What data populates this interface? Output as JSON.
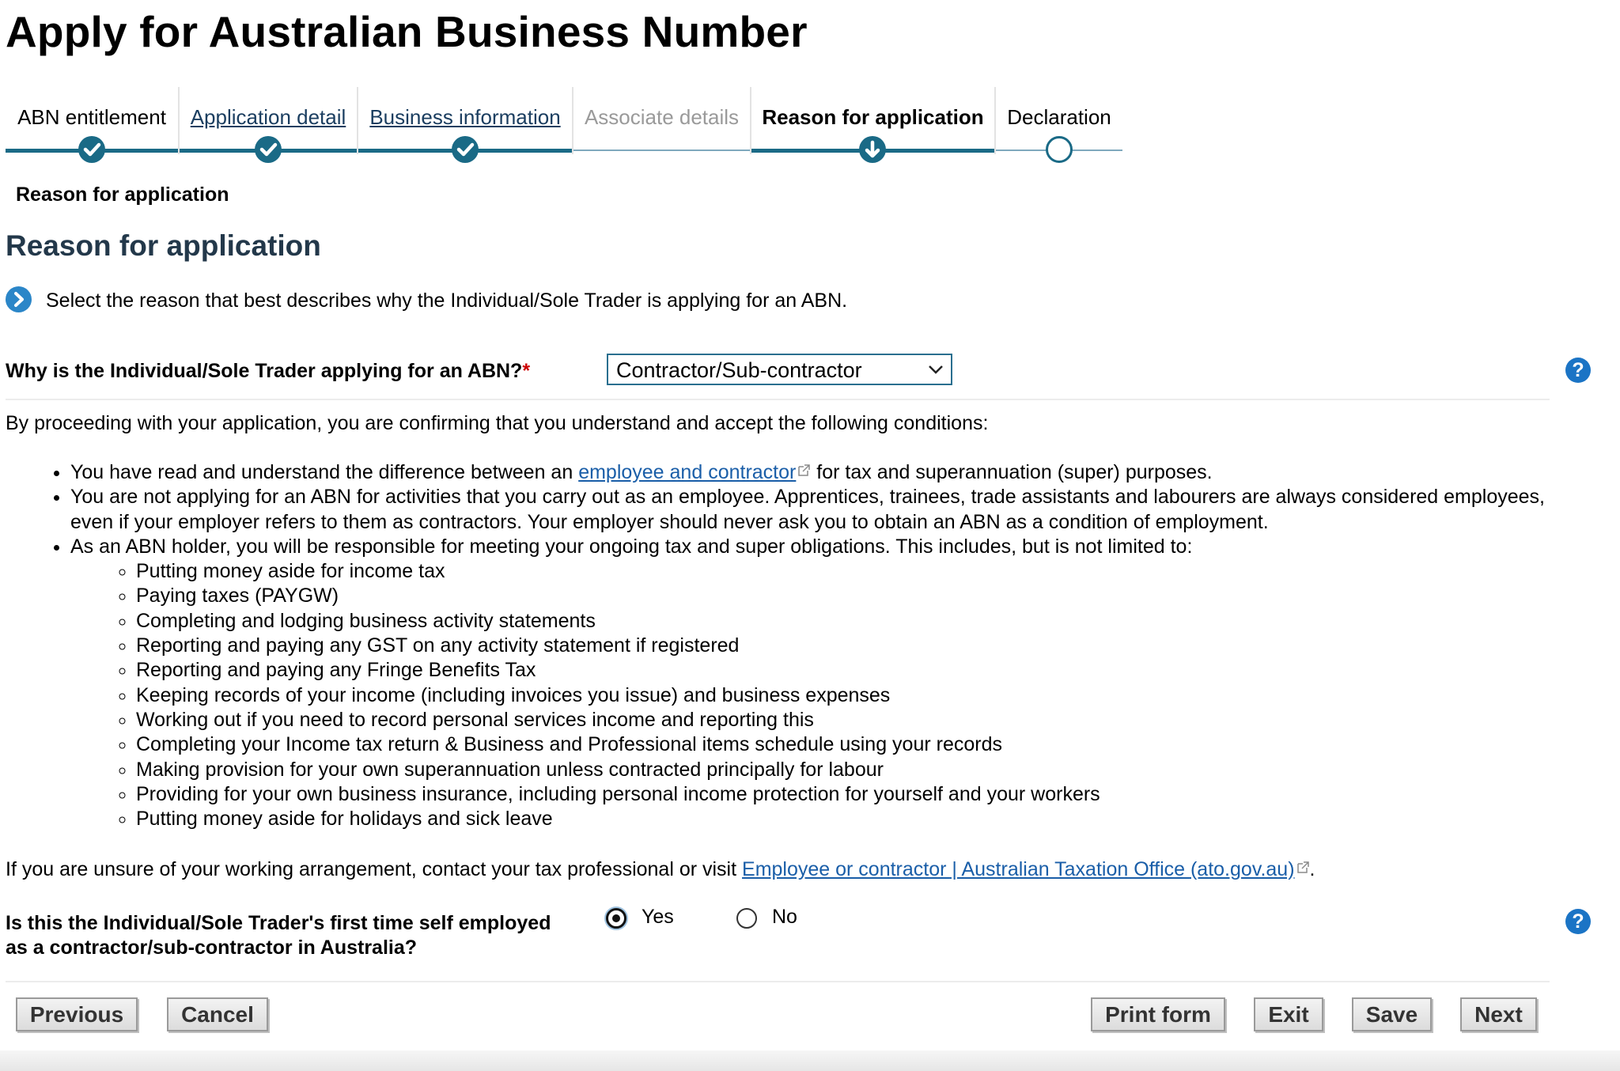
{
  "page": {
    "title": "Apply for Australian Business Number"
  },
  "steps": [
    {
      "label": "ABN entitlement",
      "state": "complete"
    },
    {
      "label": "Application detail",
      "state": "complete"
    },
    {
      "label": "Business information",
      "state": "complete"
    },
    {
      "label": "Associate details",
      "state": "disabled"
    },
    {
      "label": "Reason for application",
      "state": "current"
    },
    {
      "label": "Declaration",
      "state": "pending"
    }
  ],
  "breadcrumb": {
    "current": "Reason for application"
  },
  "section": {
    "heading": "Reason for application",
    "info_text": "Select the reason that best describes why the Individual/Sole Trader is applying for an ABN."
  },
  "question1": {
    "label": "Why is the Individual/Sole Trader applying for an ABN?",
    "required_mark": "*",
    "selected_value": "Contractor/Sub-contractor"
  },
  "conditions": {
    "intro": "By proceeding with your application, you are confirming that you understand and accept the following conditions:",
    "bullet1_before": "You have read and understand the difference between an ",
    "bullet1_link": "employee and contractor",
    "bullet1_after": " for tax and superannuation (super) purposes.",
    "bullet2": "You are not applying for an ABN for activities that you carry out as an employee. Apprentices, trainees, trade assistants and labourers are always considered employees, even if your employer refers to them as contractors. Your employer should never ask you to obtain an ABN as a condition of employment.",
    "bullet3": "As an ABN holder, you will be responsible for meeting your ongoing tax and super obligations. This includes, but is not limited to:",
    "obligations": [
      "Putting money aside for income tax",
      "Paying taxes (PAYGW)",
      "Completing and lodging business activity statements",
      "Reporting and paying any GST on any activity statement if registered",
      "Reporting and paying any Fringe Benefits Tax",
      "Keeping records of your income (including invoices you issue) and business expenses",
      "Working out if you need to record personal services income and reporting this",
      "Completing your Income tax return & Business and Professional items schedule using your records",
      "Making provision for your own superannuation unless contracted principally for labour",
      "Providing for your own business insurance, including personal income protection for yourself and your workers",
      "Putting money aside for holidays and sick leave"
    ]
  },
  "unsure": {
    "text_before": "If you are unsure of your working arrangement, contact your tax professional or visit ",
    "link": "Employee or contractor | Australian Taxation Office (ato.gov.au)",
    "text_after": "."
  },
  "question2": {
    "label_line1": "Is this the Individual/Sole Trader's first time self employed",
    "label_line2": "as a contractor/sub-contractor in Australia?",
    "options": [
      {
        "label": "Yes",
        "selected": true
      },
      {
        "label": "No",
        "selected": false
      }
    ]
  },
  "help": {
    "glyph": "?"
  },
  "buttons": {
    "previous": "Previous",
    "cancel": "Cancel",
    "print": "Print form",
    "exit": "Exit",
    "save": "Save",
    "next": "Next"
  },
  "colors": {
    "accent": "#1a6a86",
    "link": "#1a5ea8",
    "help": "#1b74c5",
    "required": "#cc0000"
  },
  "icons": {
    "step_complete": "check-icon",
    "step_current": "down-arrow-icon",
    "step_pending": "empty-circle-icon",
    "info": "chevron-right-icon",
    "help": "question-mark-icon",
    "external": "external-link-icon"
  }
}
